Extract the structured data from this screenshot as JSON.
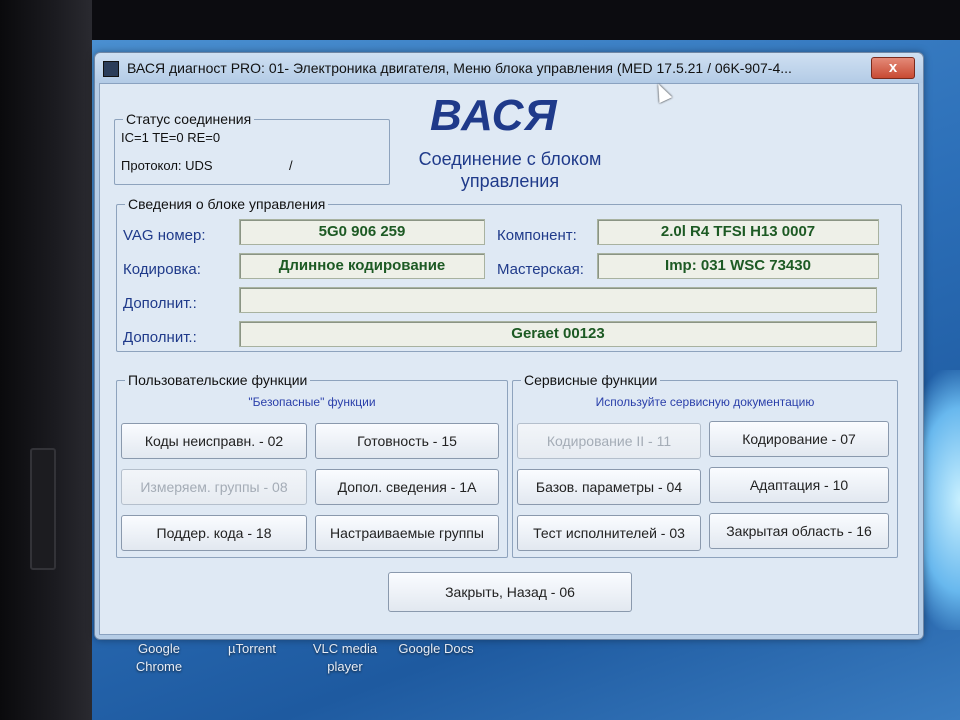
{
  "window": {
    "title": "ВАСЯ диагност PRO: 01- Электроника двигателя,  Меню блока управления (MED 17.5.21 / 06K-907-4...",
    "close_label": "x"
  },
  "status": {
    "group_title": "Статус соединения",
    "line1": "IC=1  TE=0   RE=0",
    "protocol": "Протокол: UDS",
    "slash": "/"
  },
  "header": {
    "logo": "ВАСЯ",
    "subtitle_line1": "Соединение с блоком",
    "subtitle_line2": "управления"
  },
  "ecu_info": {
    "group_title": "Сведения о блоке управления",
    "vag_label": "VAG номер:",
    "vag_value": "5G0 906 259",
    "component_label": "Компонент:",
    "component_value": "2.0l R4 TFSI   H13 0007",
    "coding_label": "Кодировка:",
    "coding_value": "Длинное кодирование",
    "workshop_label": "Мастерская:",
    "workshop_value": "Imp: 031       WSC 73430",
    "extra1_label": "Дополнит.:",
    "extra1_value": "",
    "extra2_label": "Дополнит.:",
    "extra2_value": "Geraet 00123"
  },
  "user_functions": {
    "group_title": "Пользовательские функции",
    "hint": "\"Безопасные\" функции",
    "buttons": {
      "fault_codes": "Коды неисправн. - 02",
      "readiness": "Готовность - 15",
      "measuring_groups": "Измеряем. группы - 08",
      "extra_info": "Допол. сведения - 1А",
      "code_support": "Поддер. кода - 18",
      "custom_groups": "Настраиваемые группы"
    }
  },
  "service_functions": {
    "group_title": "Сервисные функции",
    "hint": "Используйте сервисную документацию",
    "buttons": {
      "coding2": "Кодирование II - 11",
      "coding": "Кодирование - 07",
      "basic_settings": "Базов. параметры - 04",
      "adaptation": "Адаптация - 10",
      "output_test": "Тест исполнителей - 03",
      "security_access": "Закрытая область - 16"
    }
  },
  "close_back": "Закрыть, Назад - 06",
  "desktop_shortcuts": {
    "chrome": "Google Chrome",
    "utorrent": "µTorrent",
    "vlc": "VLC media player",
    "docs": "Google Docs"
  }
}
